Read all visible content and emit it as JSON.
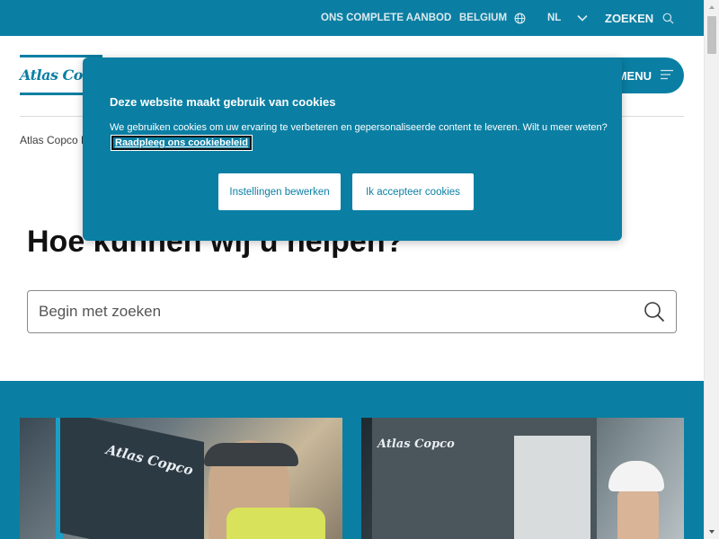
{
  "topbar": {
    "offering": "ONS COMPLETE AANBOD",
    "country": "BELGIUM",
    "language": "NL",
    "search": "ZOEKEN"
  },
  "header": {
    "logo_text": "Atlas Copco",
    "menu_label": "MENU"
  },
  "breadcrumb": {
    "text": "Atlas Copco Be"
  },
  "help": {
    "title": "Hoe kunnen wij u helpen?",
    "search_placeholder": "Begin met zoeken"
  },
  "cards": {
    "left_logo": "Atlas Copco",
    "right_logo": "Atlas Copco"
  },
  "cookie_modal": {
    "title": "Deze website maakt gebruik van cookies",
    "text": "We gebruiken cookies om uw ervaring te verbeteren en gepersonaliseerde content te leveren. Wilt u meer weten?",
    "link": "Raadpleeg ons cookiebeleid",
    "settings_button": "Instellingen bewerken",
    "accept_button": "Ik accepteer cookies"
  },
  "icons": {
    "globe": "globe-icon",
    "chevron": "chevron-down-icon",
    "search": "search-icon",
    "menu": "hamburger-icon"
  },
  "colors": {
    "brand_blue": "#0a7fa3",
    "white": "#ffffff"
  }
}
